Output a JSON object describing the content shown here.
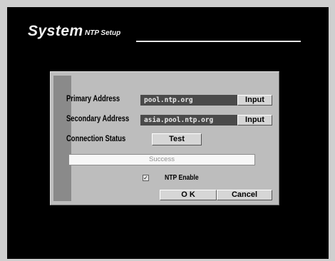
{
  "header": {
    "title": "System",
    "subtitle": "NTP Setup"
  },
  "dialog": {
    "primary": {
      "label": "Primary Address",
      "value": "pool.ntp.org",
      "button": "Input"
    },
    "secondary": {
      "label": "Secondary Address",
      "value": "asia.pool.ntp.org",
      "button": "Input"
    },
    "connection": {
      "label": "Connection Status",
      "button": "Test",
      "result": "Success"
    },
    "ntp_enable": {
      "label": "NTP Enable",
      "checked": true,
      "mark": "✓"
    },
    "ok_label": "O K",
    "cancel_label": "Cancel"
  },
  "colors": {
    "background": "#000000",
    "dialog": "#bdbdbd",
    "accent": "#8a8a8a",
    "field": "#4a4a4a"
  }
}
